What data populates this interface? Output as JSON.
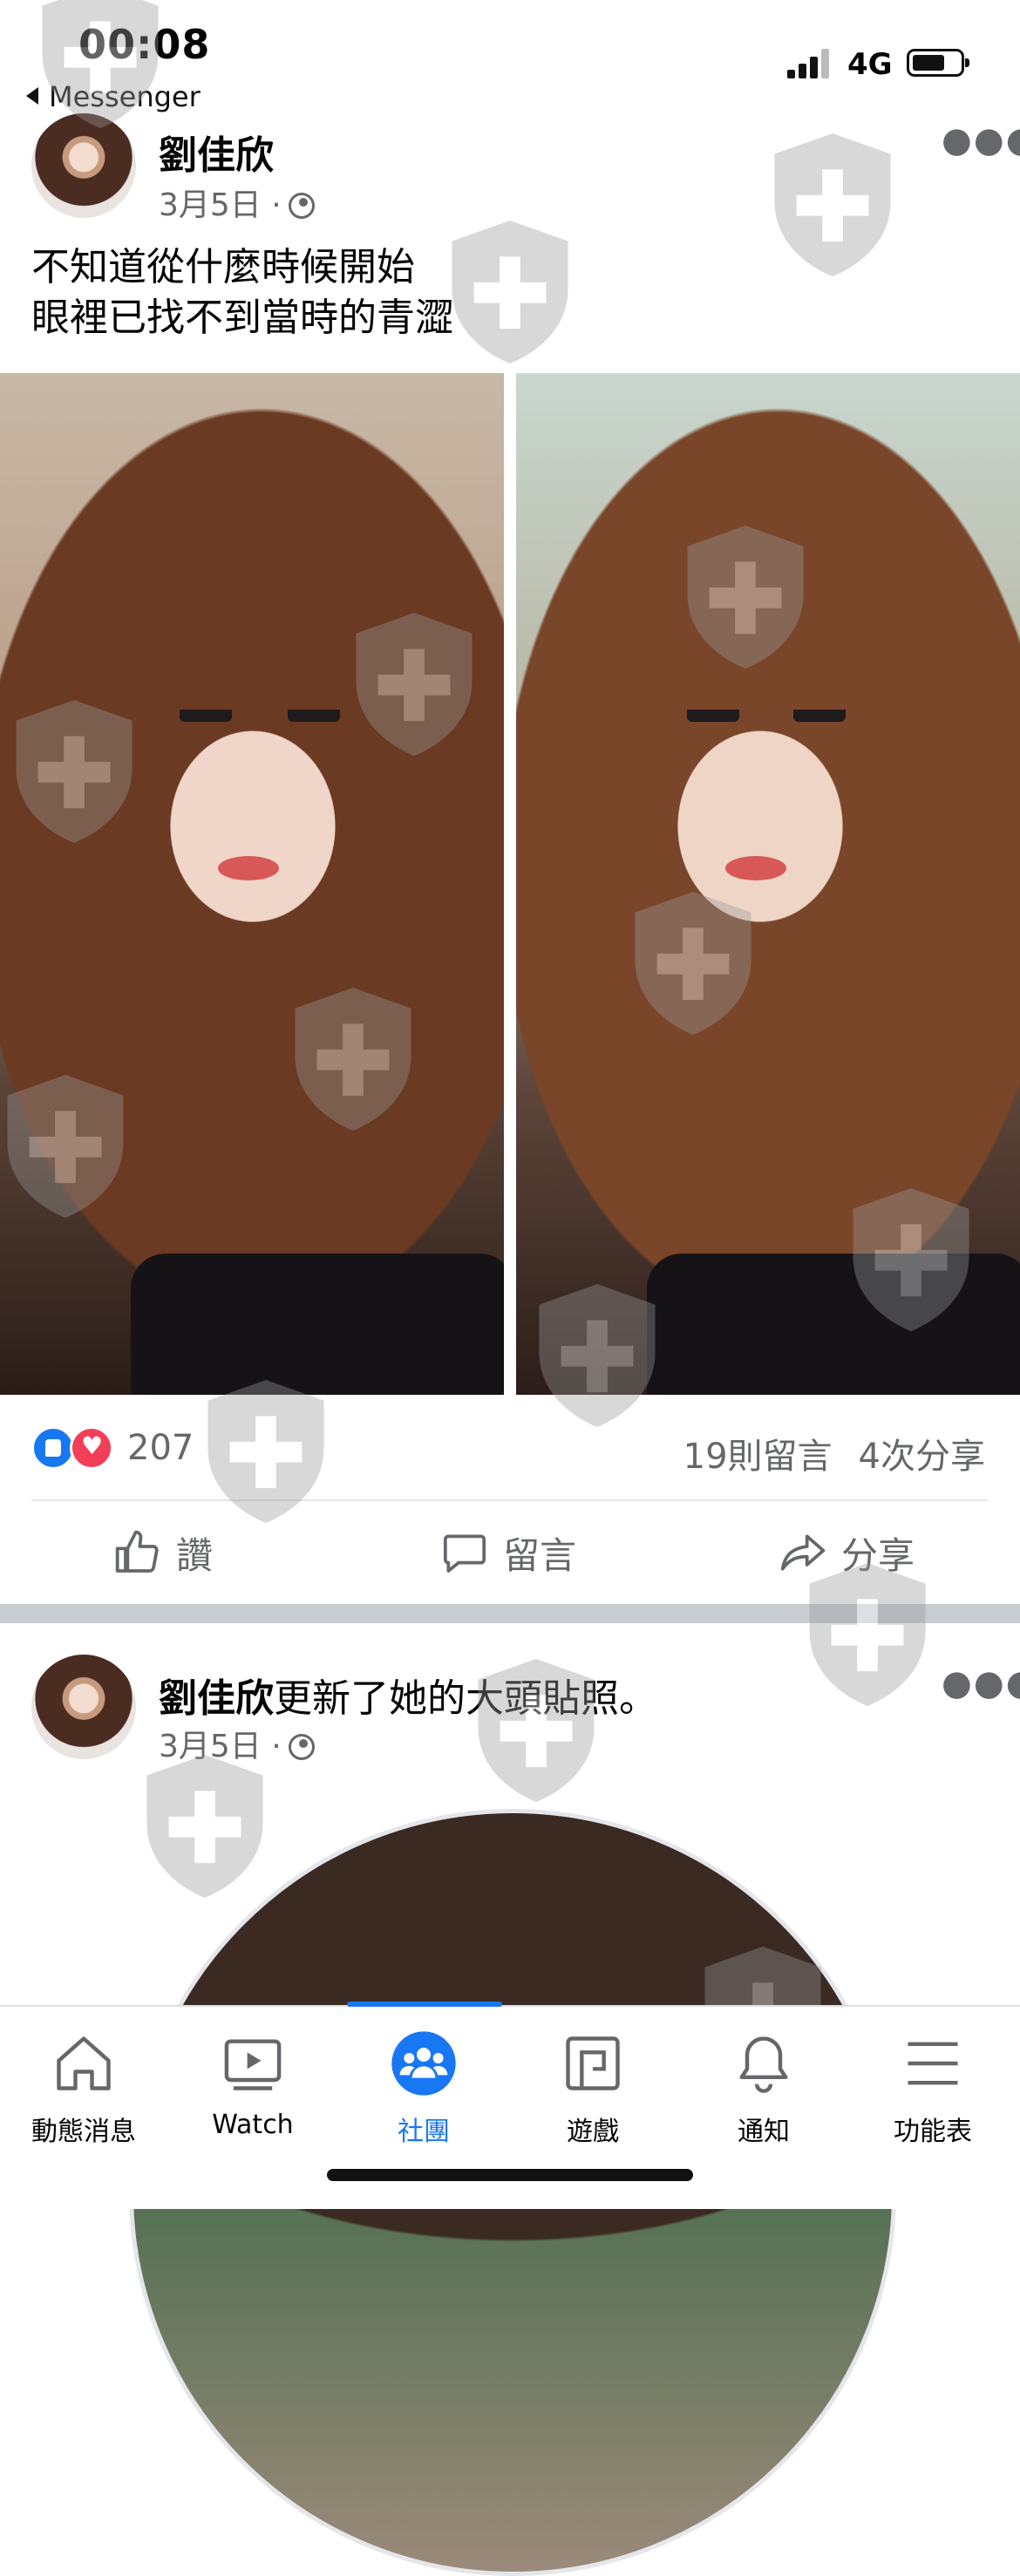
{
  "status_bar": {
    "time": "00:08",
    "back_app": "Messenger",
    "network": "4G"
  },
  "post1": {
    "author": "劉佳欣",
    "date": "3月5日",
    "text_lines": [
      "不知道從什麼時候開始",
      "眼裡已找不到當時的青澀"
    ],
    "reaction_count": "207",
    "comments": "19則留言",
    "shares": "4次分享",
    "actions": {
      "like": "讚",
      "comment": "留言",
      "share": "分享"
    }
  },
  "post2": {
    "author": "劉佳欣",
    "action_text": "更新了她的大頭貼照。",
    "date": "3月5日"
  },
  "bottom_nav": {
    "items": [
      {
        "label": "動態消息",
        "icon": "home-icon"
      },
      {
        "label": "Watch",
        "icon": "watch-icon"
      },
      {
        "label": "社團",
        "icon": "groups-icon",
        "active": true
      },
      {
        "label": "遊戲",
        "icon": "gaming-icon"
      },
      {
        "label": "通知",
        "icon": "bell-icon"
      },
      {
        "label": "功能表",
        "icon": "menu-icon"
      }
    ]
  },
  "colors": {
    "accent": "#1877f2",
    "secondary_text": "#65676b",
    "love": "#f33e58"
  }
}
